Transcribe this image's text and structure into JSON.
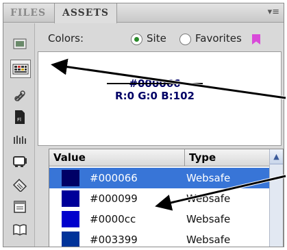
{
  "tabs": [
    {
      "label": "FILES"
    },
    {
      "label": "ASSETS"
    }
  ],
  "colors_row": {
    "label": "Colors:",
    "site_label": "Site",
    "favorites_label": "Favorites",
    "selected": "Site"
  },
  "preview": {
    "hex": "#000066",
    "rgb": "R:0 G:0 B:102"
  },
  "table": {
    "columns": [
      "Value",
      "Type"
    ],
    "rows": [
      {
        "value": "#000066",
        "type": "Websafe",
        "swatch": "#000066",
        "selected": true
      },
      {
        "value": "#000099",
        "type": "Websafe",
        "swatch": "#000099",
        "selected": false
      },
      {
        "value": "#0000cc",
        "type": "Websafe",
        "swatch": "#0000cc",
        "selected": false
      },
      {
        "value": "#003399",
        "type": "Websafe",
        "swatch": "#003399",
        "selected": false
      }
    ]
  },
  "sidebar_icons": [
    "images-icon",
    "colors-icon",
    "urls-icon",
    "flash-icon",
    "shockwave-icon",
    "movies-icon",
    "scripts-icon",
    "templates-icon",
    "library-icon"
  ],
  "active_sidebar_icon": "colors-icon",
  "colors": {
    "selection": "#3875d7",
    "preview_text": "#000066",
    "radio_dot": "#2a8a2a",
    "favorites_icon": "#d94ad9"
  }
}
